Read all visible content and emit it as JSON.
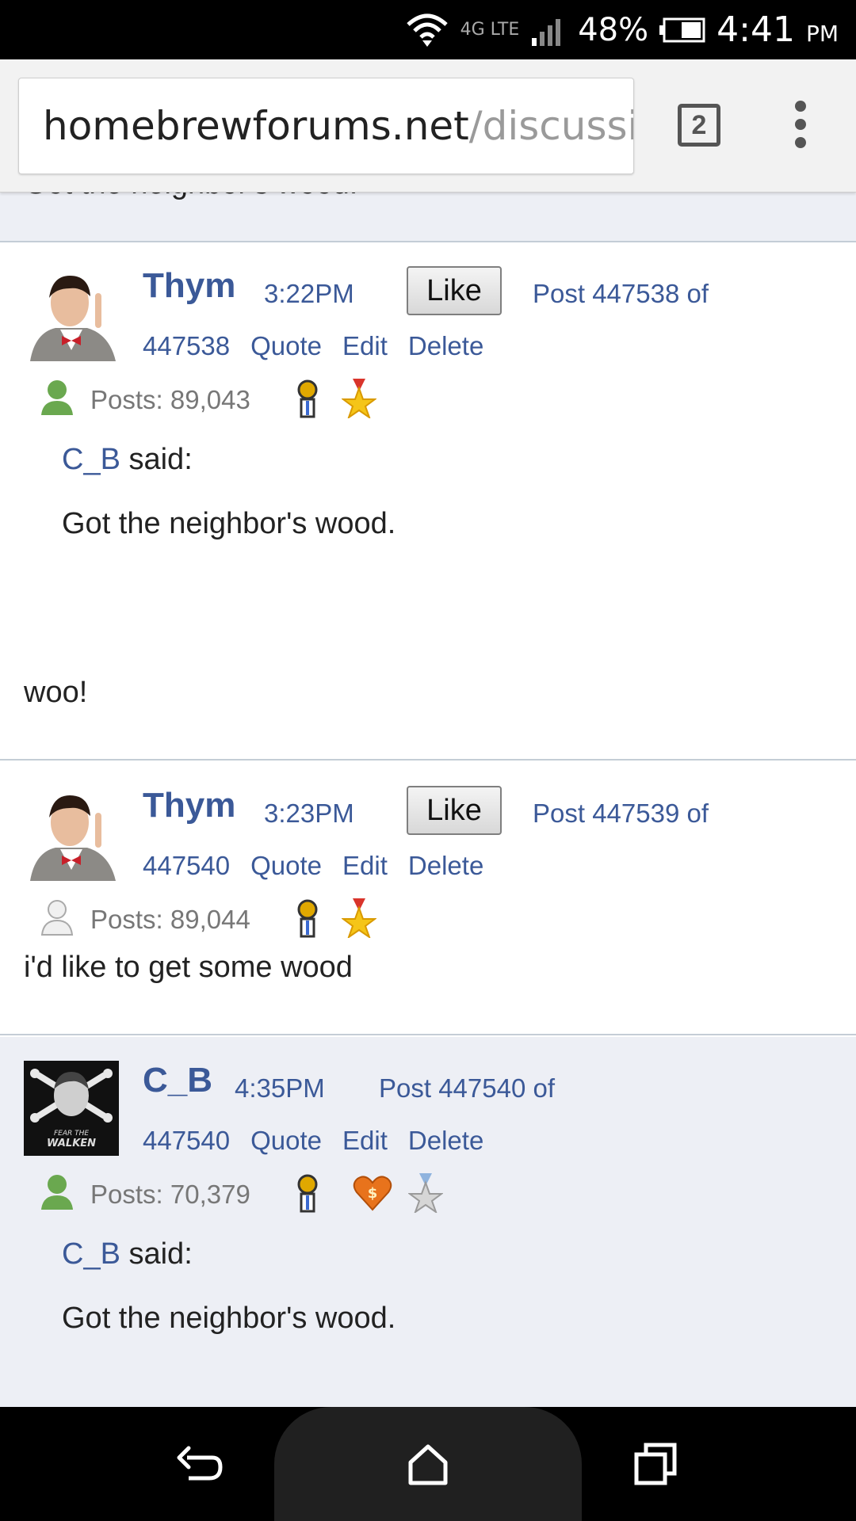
{
  "status_bar": {
    "network": "4G LTE",
    "battery_percent": "48%",
    "time": "4:41",
    "ampm": "PM"
  },
  "browser": {
    "url_host": "homebrewforums.net",
    "url_path": "/discussic",
    "tab_count": "2"
  },
  "cut_off_text": "Got the neighbor's wood.",
  "posts": [
    {
      "username": "Thym",
      "time": "3:22PM",
      "like_label": "Like",
      "post_label": "Post 447538 of",
      "post_total": "447538",
      "actions": [
        "Quote",
        "Edit",
        "Delete"
      ],
      "posts_count": "Posts: 89,043",
      "quote_author": "C_B",
      "quote_said": " said:",
      "quote_text": "Got the neighbor's wood.",
      "body": "woo!",
      "online": true
    },
    {
      "username": "Thym",
      "time": "3:23PM",
      "like_label": "Like",
      "post_label": "Post 447539 of",
      "post_total": "447540",
      "actions": [
        "Quote",
        "Edit",
        "Delete"
      ],
      "posts_count": "Posts: 89,044",
      "body": "i'd like to get some wood",
      "online": false
    },
    {
      "username": "C_B",
      "time": "4:35PM",
      "post_label": "Post 447540 of",
      "post_total": "447540",
      "actions": [
        "Quote",
        "Edit",
        "Delete"
      ],
      "posts_count": "Posts: 70,379",
      "quote_author": "C_B",
      "quote_said": " said:",
      "quote_text": "Got the neighbor's wood.",
      "avatar_text": "FEAR THE WALKEN",
      "online": true
    }
  ],
  "colors": {
    "link": "#3b5998",
    "alt_row_bg": "#edeff5",
    "divider": "#c4cdd6",
    "online": "#6aa84f",
    "offline": "#bdbdbd"
  },
  "icons": [
    "wifi-icon",
    "signal-icon",
    "battery-icon",
    "tabs-icon",
    "overflow-menu-icon",
    "back-icon",
    "home-icon",
    "recents-icon",
    "online-status-icon",
    "offline-status-icon",
    "member-badge-icon",
    "star-award-icon",
    "heart-supporter-icon",
    "silver-star-icon"
  ]
}
